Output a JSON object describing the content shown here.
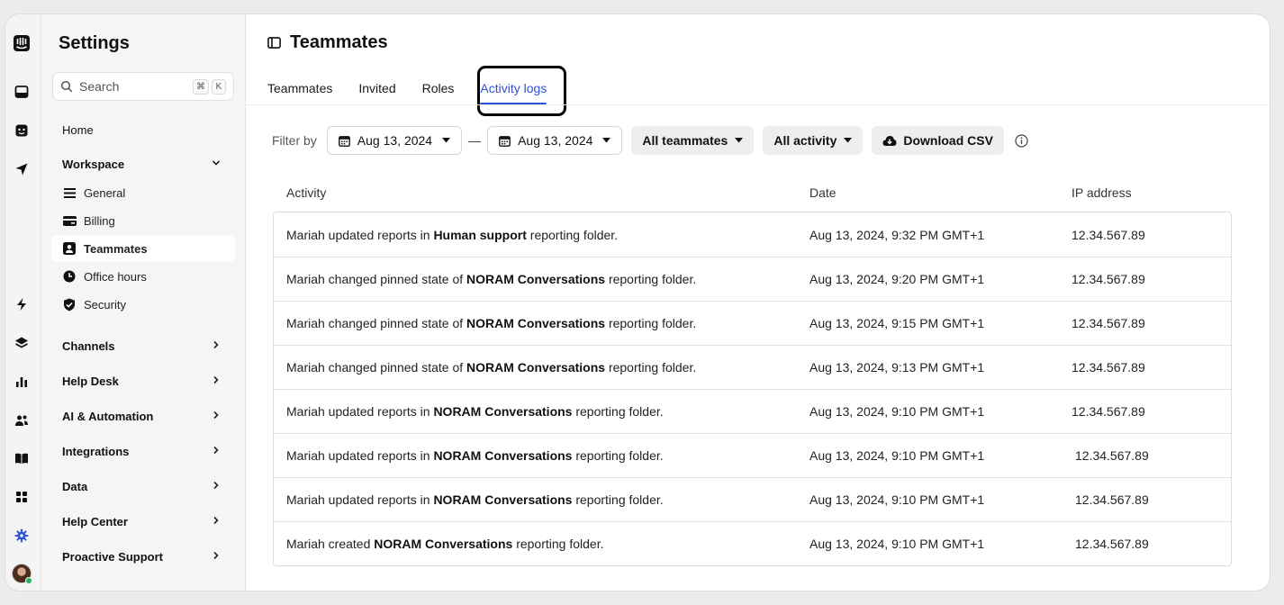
{
  "sidebar": {
    "title": "Settings",
    "search_placeholder": "Search",
    "shortcut_cmd": "⌘",
    "shortcut_key": "K",
    "home": "Home",
    "workspace": "Workspace",
    "workspace_items": [
      "General",
      "Billing",
      "Teammates",
      "Office hours",
      "Security"
    ],
    "sections": [
      "Channels",
      "Help Desk",
      "AI & Automation",
      "Integrations",
      "Data",
      "Help Center",
      "Proactive Support"
    ]
  },
  "header": {
    "title": "Teammates"
  },
  "tabs": [
    "Teammates",
    "Invited",
    "Roles",
    "Activity logs"
  ],
  "active_tab": "Activity logs",
  "filters": {
    "label": "Filter by",
    "date_from": "Aug 13, 2024",
    "date_to": "Aug 13, 2024",
    "separator": "—",
    "teammates": "All teammates",
    "activity": "All activity",
    "download": "Download CSV"
  },
  "table": {
    "columns": [
      "Activity",
      "Date",
      "IP address"
    ],
    "rows": [
      {
        "pre": "Mariah updated reports in ",
        "bold": "Human support",
        "post": " reporting folder.",
        "date": "Aug 13, 2024, 9:32 PM GMT+1",
        "ip": "12.34.567.89"
      },
      {
        "pre": "Mariah changed pinned state of ",
        "bold": "NORAM Conversations",
        "post": " reporting folder.",
        "date": "Aug 13, 2024, 9:20 PM GMT+1",
        "ip": "12.34.567.89"
      },
      {
        "pre": "Mariah changed pinned state of ",
        "bold": "NORAM Conversations",
        "post": " reporting folder.",
        "date": "Aug 13, 2024, 9:15 PM GMT+1",
        "ip": "12.34.567.89"
      },
      {
        "pre": "Mariah changed pinned state of ",
        "bold": "NORAM Conversations",
        "post": " reporting folder.",
        "date": "Aug 13, 2024, 9:13 PM GMT+1",
        "ip": "12.34.567.89"
      },
      {
        "pre": "Mariah updated reports in ",
        "bold": "NORAM Conversations",
        "post": " reporting folder.",
        "date": "Aug 13, 2024, 9:10 PM GMT+1",
        "ip": "12.34.567.89"
      },
      {
        "pre": "Mariah updated reports in ",
        "bold": "NORAM Conversations",
        "post": " reporting folder.",
        "date": "Aug 13, 2024, 9:10 PM GMT+1",
        "ip": "12.34.567.89"
      },
      {
        "pre": "Mariah updated reports in ",
        "bold": "NORAM Conversations",
        "post": " reporting folder.",
        "date": "Aug 13, 2024, 9:10 PM GMT+1",
        "ip": "12.34.567.89"
      },
      {
        "pre": "Mariah created ",
        "bold": "NORAM Conversations",
        "post": " reporting folder.",
        "date": "Aug 13, 2024, 9:10 PM GMT+1",
        "ip": "12.34.567.89"
      }
    ]
  },
  "colors": {
    "accent": "#2f52d4",
    "sidebar_bg": "#f5f5f5",
    "status_online": "#2db15b"
  }
}
